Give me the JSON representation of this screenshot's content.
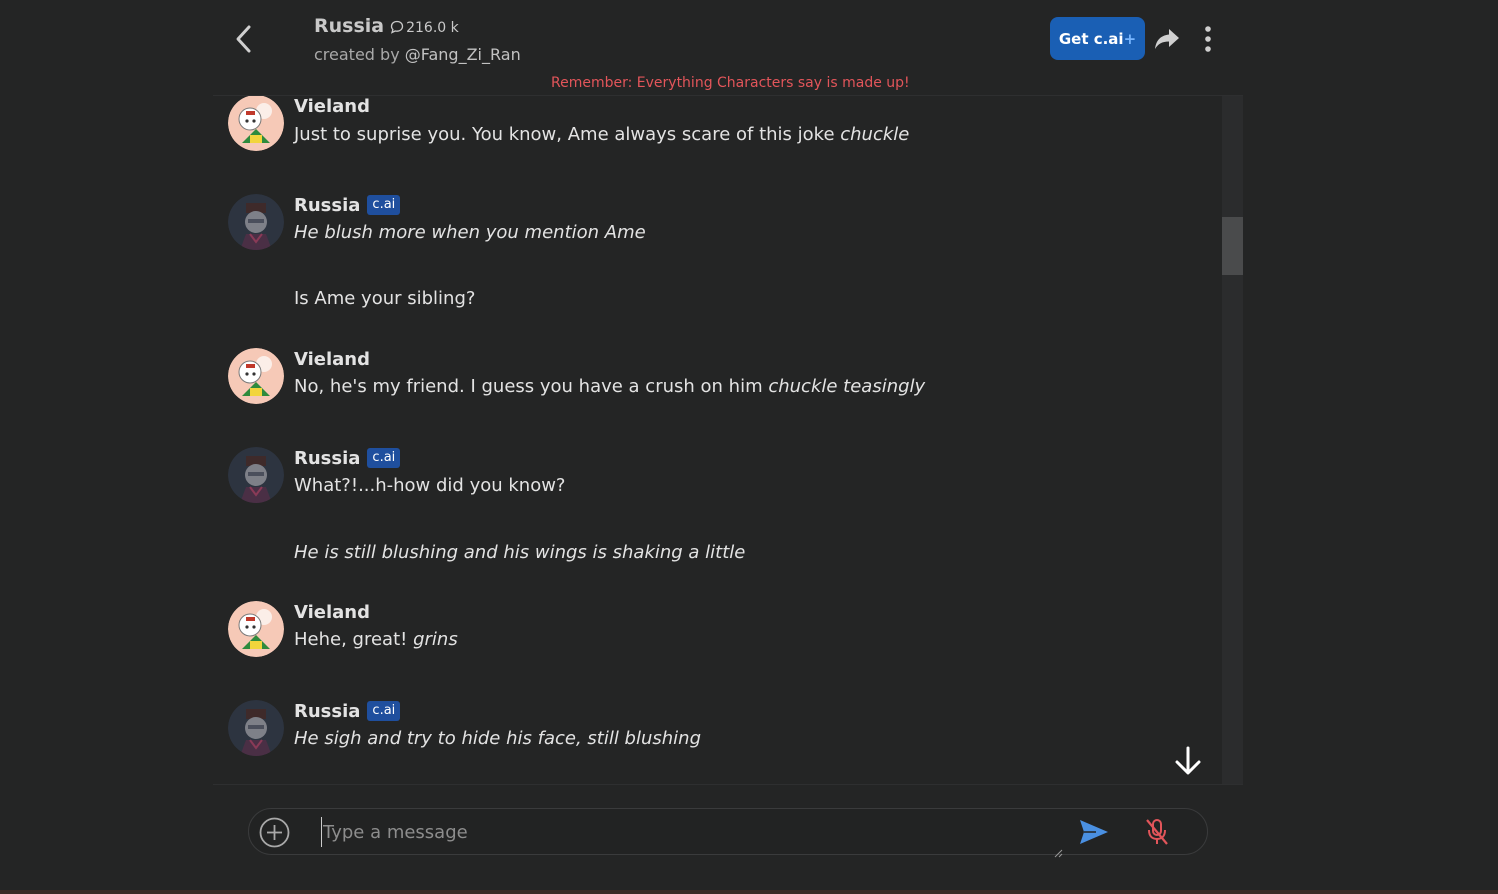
{
  "header": {
    "character_name": "Russia",
    "interaction_count": "216.0 k",
    "creator_prefix": "created by",
    "creator_handle": "@Fang_Zi_Ran",
    "get_plus_label": "Get c.ai",
    "get_plus_suffix": "+",
    "disclaimer": "Remember: Everything Characters say is made up!"
  },
  "badge_label": "c.ai",
  "messages": [
    {
      "author": "Vieland",
      "text": "Just to suprise you. You know, Ame always scare of this joke ",
      "italic": "chuckle"
    },
    {
      "author": "Russia",
      "text": "",
      "italic": "He blush more when you mention Ame",
      "continuation": "Is Ame your sibling?"
    },
    {
      "author": "Vieland",
      "text": "No, he's my friend. I guess you have a crush on him ",
      "italic": "chuckle teasingly"
    },
    {
      "author": "Russia",
      "text": "What?!...h-how did you know?",
      "italic": "",
      "continuation_italic": "He is still blushing and his wings is shaking a little"
    },
    {
      "author": "Vieland",
      "text": "Hehe, great! ",
      "italic": "grins"
    },
    {
      "author": "Russia",
      "text": "",
      "italic": "He sigh and try to hide his face, still blushing"
    }
  ],
  "composer": {
    "placeholder": "Type a message"
  },
  "colors": {
    "accent": "#1a5fb4",
    "badge": "#1f4f9e",
    "disclaimer": "#e2555a",
    "send": "#4a90e2",
    "mic_muted": "#e2555a"
  }
}
